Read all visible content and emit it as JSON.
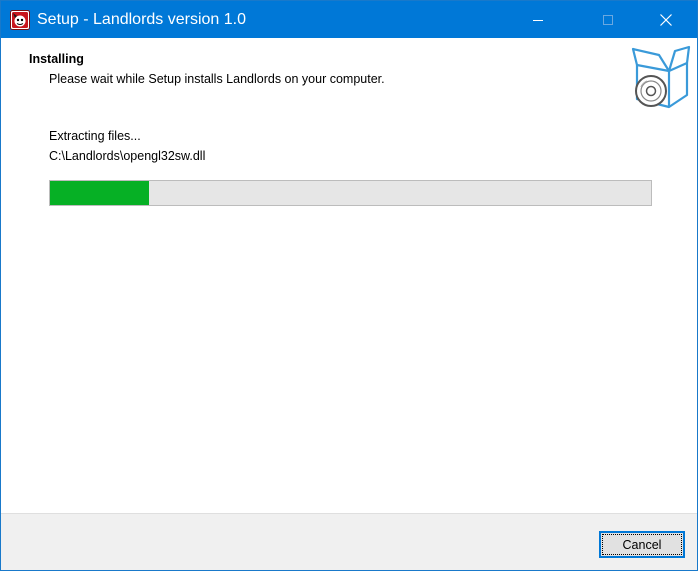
{
  "window": {
    "title": "Setup - Landlords version 1.0",
    "accent_color": "#0078d7",
    "caption_icons": [
      "minimize-icon",
      "maximize-icon",
      "close-icon"
    ]
  },
  "header": {
    "heading": "Installing",
    "subheading": "Please wait while Setup installs Landlords on your computer.",
    "icon": "software-box-disc-icon"
  },
  "progress": {
    "status": "Extracting files...",
    "current_file": "C:\\Landlords\\opengl32sw.dll",
    "fraction": 0.165,
    "fill_color": "#06b025"
  },
  "footer": {
    "cancel_label": "Cancel"
  }
}
